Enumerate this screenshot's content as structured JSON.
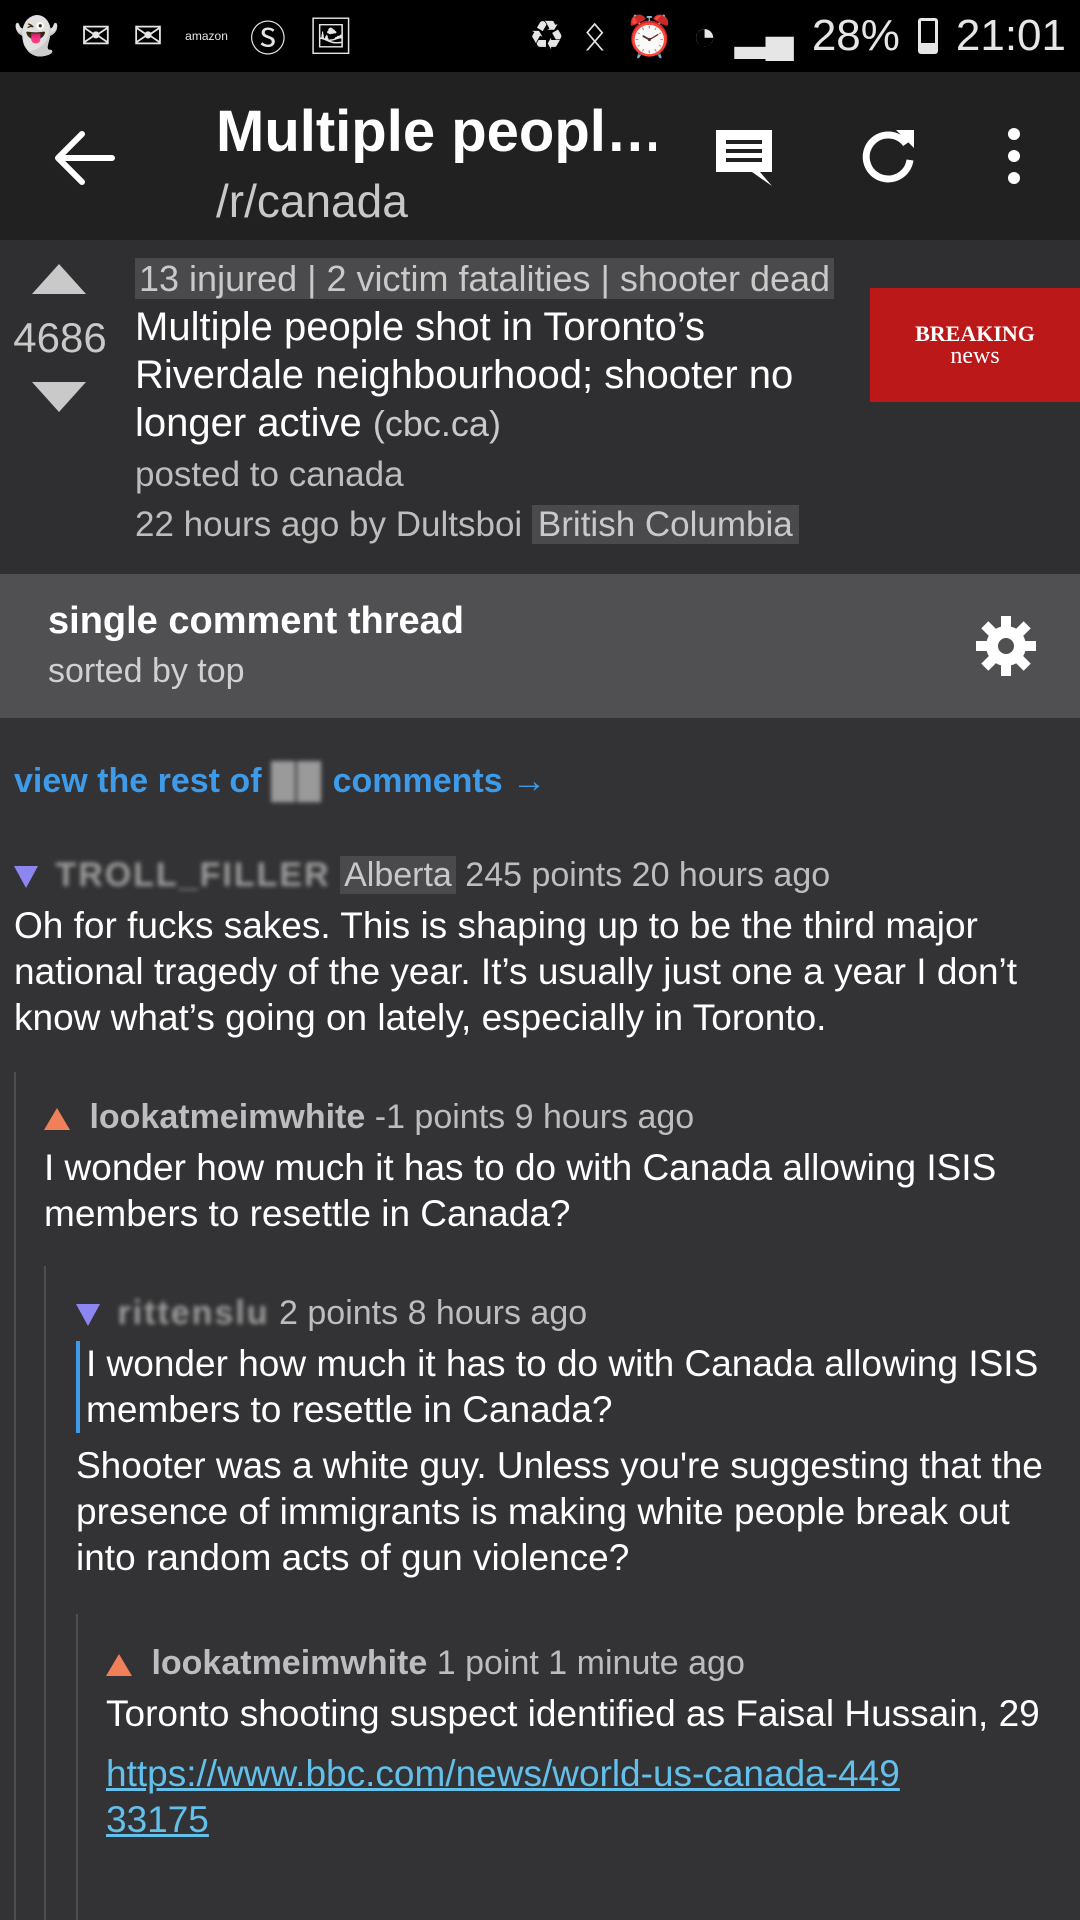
{
  "status_bar": {
    "amazon_label": "amazon",
    "battery_pct": "28%",
    "time": "21:01"
  },
  "app_bar": {
    "title": "Multiple peopl…",
    "subreddit": "/r/canada"
  },
  "post": {
    "score": "4686",
    "flair": "13 injured | 2 victim fatalities | shooter dead",
    "title": "Multiple people shot in Toronto’s Riverdale neighbourhood; shooter no longer active",
    "domain": "(cbc.ca)",
    "posted_to": "posted to canada",
    "time_by": "22 hours ago by Dultsboi",
    "user_flair": "British Columbia",
    "thumbnail_line1": "BREAKING",
    "thumbnail_line2": "news"
  },
  "thread": {
    "title": "single comment thread",
    "sort": "sorted by top"
  },
  "rest_link": {
    "prefix": "view the rest of",
    "suffix": "comments →"
  },
  "comments": [
    {
      "author": "TROLL_FILLER",
      "flair": "Alberta",
      "points": "245 points",
      "time": "20 hours ago",
      "body": "Oh for fucks sakes. This is shaping up to be the third major national tragedy of the year. It’s usually just one a year I don’t know what’s going on lately, especially in Toronto."
    },
    {
      "author": "lookatmeimwhite",
      "points": "-1 points",
      "time": "9 hours ago",
      "body": "I wonder how much it has to do with Canada allowing ISIS members to resettle in Canada?"
    },
    {
      "author": "rittenslu",
      "points": "2 points",
      "time": "8 hours ago",
      "quote": "I wonder how much it has to do with Canada allowing ISIS members to resettle in Canada?",
      "body": "Shooter was a white guy. Unless you're suggesting that the presence of immigrants is making white people break out into random acts of gun violence?"
    },
    {
      "author": "lookatmeimwhite",
      "points": "1 point",
      "time": "1 minute ago",
      "body": "Toronto shooting suspect identified as Faisal Hussain, 29",
      "link": "https://www.bbc.com/news/world-us-canada-44933175"
    }
  ]
}
